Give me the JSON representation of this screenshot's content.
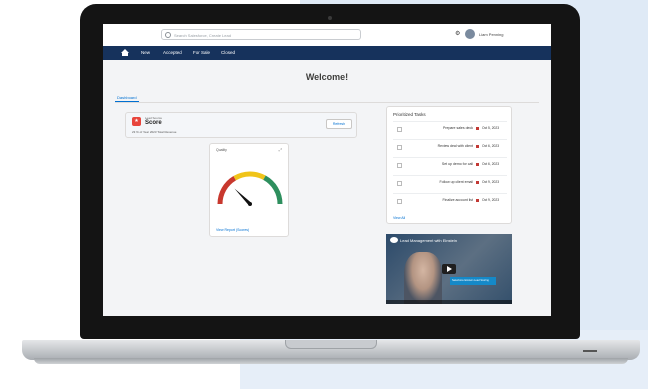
{
  "app": {
    "search_placeholder": "Search Salesforce, Create Lead",
    "user_label": "Liam Penning",
    "nav_items": [
      "Home",
      "New",
      "Accepted",
      "For Sale",
      "Closed"
    ],
    "welcome_title": "Welcome!",
    "active_tab": "Dashboard"
  },
  "lead": {
    "small_label": "Lead Source",
    "title": "Score",
    "detail_line": "23 % of Year 2023  Total Revenue",
    "button_label": "Refresh"
  },
  "gauge": {
    "title": "Quality",
    "value_fraction": 0.25,
    "link_label": "View Report (Scores)",
    "colors": {
      "low": "#c8382e",
      "mid": "#f0c419",
      "high": "#2e8f5e"
    }
  },
  "tasks": {
    "title": "Prioritized Tasks",
    "rows": [
      {
        "name": "Prepare sales deck",
        "date": "Oct 5, 2023",
        "flag": "#c23934"
      },
      {
        "name": "Review deal with client",
        "date": "Oct 6, 2023",
        "flag": "#c23934"
      },
      {
        "name": "Set up demo for call",
        "date": "Oct 6, 2023",
        "flag": "#c23934"
      },
      {
        "name": "Follow up client email",
        "date": "Oct 9, 2023",
        "flag": "#c23934"
      },
      {
        "name": "Finalize account list",
        "date": "Oct 9, 2023",
        "flag": "#c23934"
      }
    ],
    "view_all": "View All"
  },
  "video": {
    "title": "Lead Management with Einstein",
    "banner": "Salesforce Einstein Lead Scoring"
  }
}
